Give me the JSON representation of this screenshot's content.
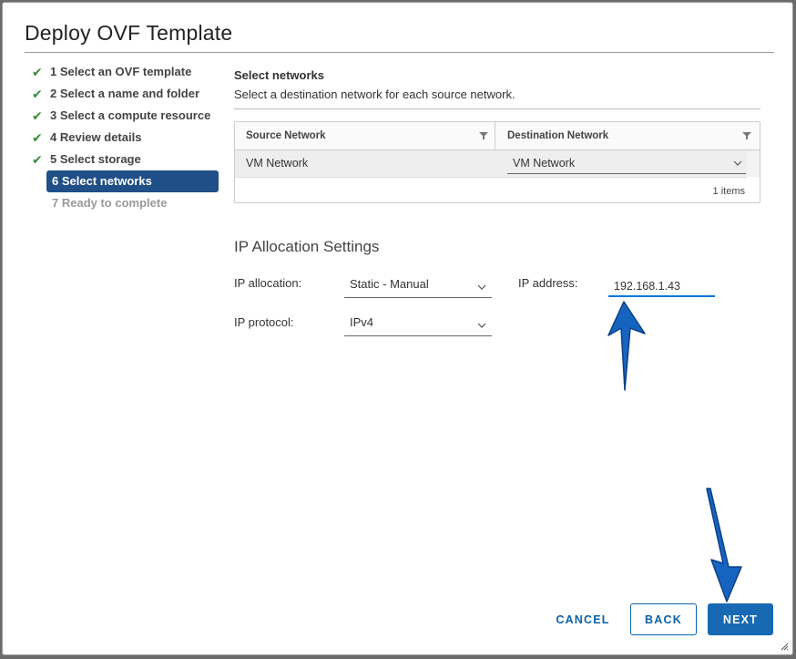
{
  "dialog": {
    "title": "Deploy OVF Template"
  },
  "steps": [
    {
      "label": "1 Select an OVF template",
      "state": "done"
    },
    {
      "label": "2 Select a name and folder",
      "state": "done"
    },
    {
      "label": "3 Select a compute resource",
      "state": "done"
    },
    {
      "label": "4 Review details",
      "state": "done"
    },
    {
      "label": "5 Select storage",
      "state": "done"
    },
    {
      "label": "6 Select networks",
      "state": "active"
    },
    {
      "label": "7 Ready to complete",
      "state": "pending"
    }
  ],
  "networks": {
    "title": "Select networks",
    "subtitle": "Select a destination network for each source network.",
    "columns": [
      "Source Network",
      "Destination Network"
    ],
    "rows": [
      {
        "source": "VM Network",
        "destination": "VM Network"
      }
    ],
    "footer": "1 items"
  },
  "ip_settings": {
    "title": "IP Allocation Settings",
    "allocation_label": "IP allocation:",
    "allocation_value": "Static - Manual",
    "protocol_label": "IP protocol:",
    "protocol_value": "IPv4",
    "address_label": "IP address:",
    "address_value": "192.168.1.43"
  },
  "buttons": {
    "cancel": "CANCEL",
    "back": "BACK",
    "next": "NEXT"
  },
  "colors": {
    "accent": "#1769b4",
    "active_step": "#1f4f86",
    "check": "#3c8b3c",
    "annotation_arrow": "#1565c0"
  }
}
